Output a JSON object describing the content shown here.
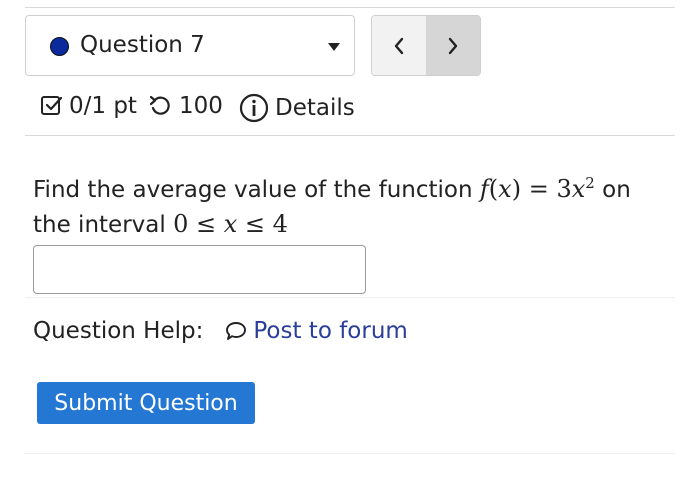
{
  "question_selector": {
    "label": "Question 7",
    "dot_color": "#0a2a9e"
  },
  "nav": {
    "prev_symbol": "<",
    "next_symbol": ">"
  },
  "meta": {
    "score": "0/1 pt",
    "retries": "100",
    "details": "Details"
  },
  "question": {
    "text_before": "Find the average value of the function ",
    "fx_f": "f",
    "fx_open": "(",
    "fx_x": "x",
    "fx_close": ")",
    "fx_eq": " = 3",
    "fx_var": "x",
    "fx_exp": "2",
    "text_on": " on",
    "text_interval": "the interval ",
    "int_lo": "0 ≤ ",
    "int_var": "x",
    "int_hi": " ≤ 4"
  },
  "answer": {
    "value": ""
  },
  "help": {
    "label": "Question Help:",
    "forum_label": "Post to forum"
  },
  "submit": {
    "label": "Submit Question",
    "color": "#2478d4"
  },
  "icons": [
    "checkbox-icon",
    "retry-icon",
    "info-icon",
    "speech-bubble-icon",
    "chevron-left-icon",
    "chevron-right-icon",
    "caret-down-icon"
  ]
}
